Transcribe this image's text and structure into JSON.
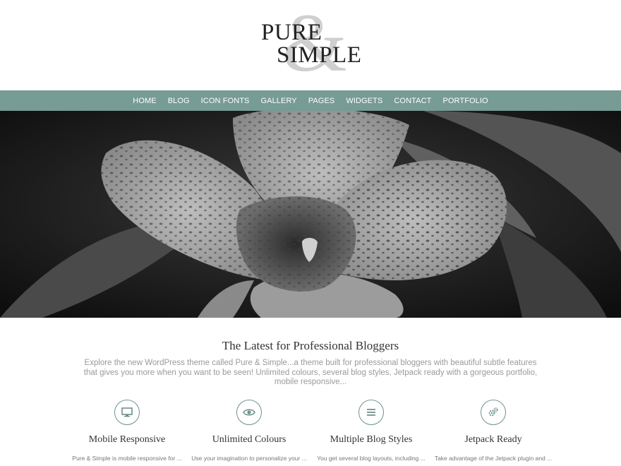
{
  "logo": {
    "line1": "PURE",
    "line2": "SIMPLE",
    "ampersand": "&"
  },
  "nav": {
    "items": [
      "HOME",
      "BLOG",
      "ICON FONTS",
      "GALLERY",
      "PAGES",
      "WIDGETS",
      "CONTACT",
      "PORTFOLIO"
    ]
  },
  "hero": {
    "image": "black-and-white orchid"
  },
  "intro": {
    "title": "The Latest for Professional Bloggers",
    "text": "Explore the new WordPress theme called Pure & Simple...a theme built for professional bloggers with beautiful subtle features that gives you more when you want to be seen! Unlimited colours, several blog styles, Jetpack ready with a gorgeous portfolio, mobile responsive..."
  },
  "features": [
    {
      "icon": "monitor-icon",
      "title": "Mobile Responsive",
      "text": "Pure & Simple is mobile responsive for ..."
    },
    {
      "icon": "eye-icon",
      "title": "Unlimited Colours",
      "text": "Use your imagination to personalize your ..."
    },
    {
      "icon": "list-icon",
      "title": "Multiple Blog Styles",
      "text": "You get several blog layouts, including ..."
    },
    {
      "icon": "gears-icon",
      "title": "Jetpack Ready",
      "text": "Take advantage of the Jetpack plugin and ..."
    }
  ],
  "colors": {
    "accent": "#779b95",
    "icon_border": "#6e938d"
  }
}
